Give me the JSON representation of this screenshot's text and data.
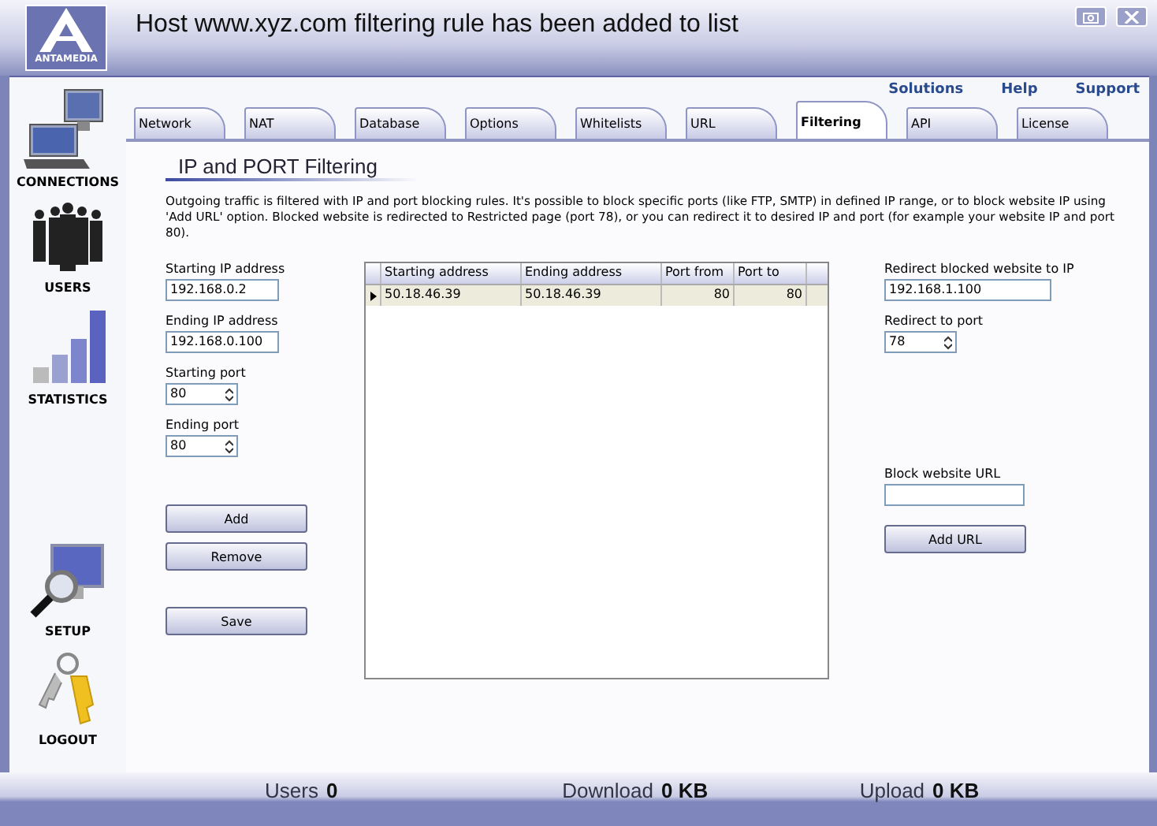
{
  "window": {
    "title": "Host www.xyz.com filtering rule has been added to list",
    "logo": "ANTAMEDIA"
  },
  "top_links": [
    "Solutions",
    "Help",
    "Support"
  ],
  "sidebar": {
    "items": [
      {
        "label": "CONNECTIONS",
        "kind": "connections"
      },
      {
        "label": "USERS",
        "kind": "users"
      },
      {
        "label": "STATISTICS",
        "kind": "statistics"
      },
      {
        "label": "SETUP",
        "kind": "setup"
      },
      {
        "label": "LOGOUT",
        "kind": "logout"
      }
    ]
  },
  "tabs": [
    {
      "label": "Network",
      "selected": false
    },
    {
      "label": "NAT",
      "selected": false
    },
    {
      "label": "Database",
      "selected": false
    },
    {
      "label": "Options",
      "selected": false
    },
    {
      "label": "Whitelists",
      "selected": false
    },
    {
      "label": "URL",
      "selected": false
    },
    {
      "label": "Filtering",
      "selected": true
    },
    {
      "label": "API",
      "selected": false
    },
    {
      "label": "License",
      "selected": false
    }
  ],
  "heading": "IP and PORT Filtering",
  "description": "Outgoing traffic is filtered with IP and port blocking rules. It's possible to block specific ports (like FTP, SMTP) in defined IP range, or to block website IP using 'Add URL' option. Blocked website is redirected to Restricted page (port 78), or you can redirect it to desired IP and port (for example your website IP and port 80).",
  "left_fields": [
    {
      "label": "Starting IP address",
      "value": "192.168.0.2",
      "kind": "text"
    },
    {
      "label": "Ending IP address",
      "value": "192.168.0.100",
      "kind": "text"
    },
    {
      "label": "Starting port",
      "value": "80",
      "kind": "spin"
    },
    {
      "label": "Ending port",
      "value": "80",
      "kind": "spin"
    }
  ],
  "left_buttons": [
    "Add",
    "Remove"
  ],
  "save_button": "Save",
  "table": {
    "columns": [
      "Starting address",
      "Ending address",
      "Port from",
      "Port to"
    ],
    "rows": [
      {
        "cells": [
          "50.18.46.39",
          "50.18.46.39",
          "80",
          "80"
        ],
        "selected": true
      }
    ]
  },
  "right_fields": [
    {
      "label": "Redirect blocked website to IP",
      "value": "192.168.1.100",
      "kind": "text"
    },
    {
      "label": "Redirect to port",
      "value": "78",
      "kind": "spin"
    }
  ],
  "url_field": {
    "label": "Block website URL"
  },
  "add_url_button": "Add URL",
  "status_bar": [
    {
      "label": "Users",
      "value": "0"
    },
    {
      "label": "Download",
      "value": "0 KB"
    },
    {
      "label": "Upload",
      "value": "0 KB"
    }
  ]
}
